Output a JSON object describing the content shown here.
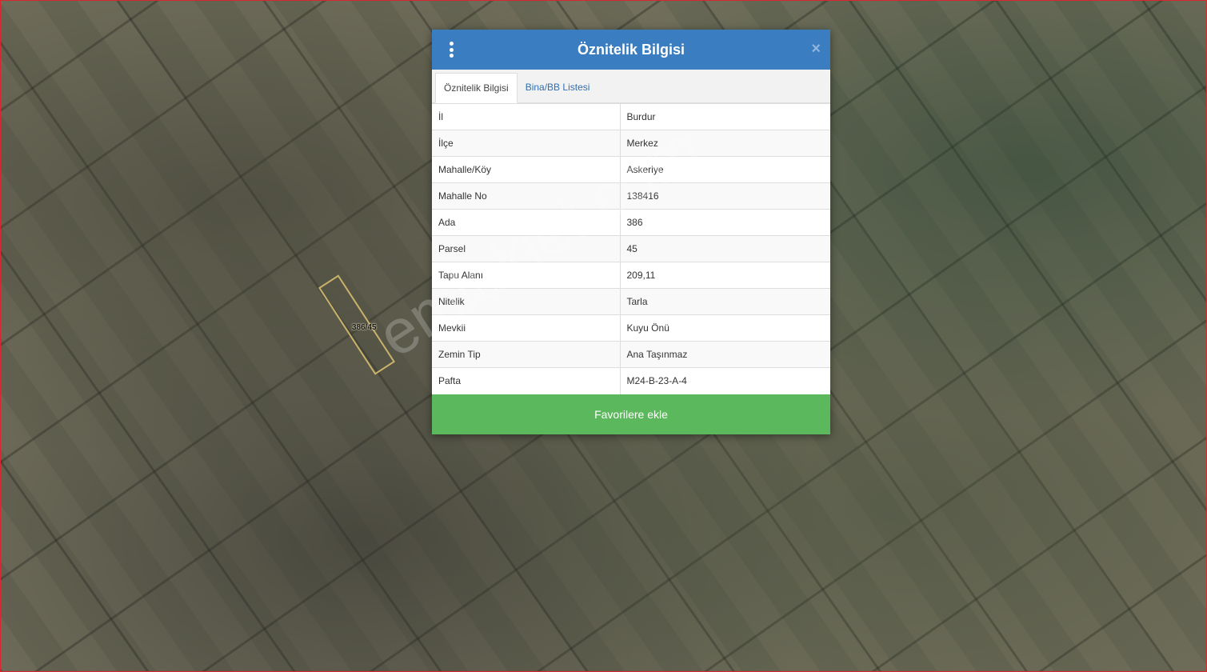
{
  "map": {
    "parcel_label": "386/45"
  },
  "watermark": "emlakjet.com",
  "dialog": {
    "title": "Öznitelik Bilgisi",
    "menu_icon": "vertical-dots-icon",
    "close_label": "×",
    "tabs": [
      {
        "label": "Öznitelik Bilgisi",
        "active": true
      },
      {
        "label": "Bina/BB Listesi",
        "active": false
      }
    ],
    "rows": [
      {
        "key": "İl",
        "value": "Burdur"
      },
      {
        "key": "İlçe",
        "value": "Merkez"
      },
      {
        "key": "Mahalle/Köy",
        "value": "Askeriye"
      },
      {
        "key": "Mahalle No",
        "value": "138416"
      },
      {
        "key": "Ada",
        "value": "386"
      },
      {
        "key": "Parsel",
        "value": "45"
      },
      {
        "key": "Tapu Alanı",
        "value": "209,11"
      },
      {
        "key": "Nitelik",
        "value": "Tarla"
      },
      {
        "key": "Mevkii",
        "value": "Kuyu Önü"
      },
      {
        "key": "Zemin Tip",
        "value": "Ana Taşınmaz"
      },
      {
        "key": "Pafta",
        "value": "M24-B-23-A-4"
      }
    ],
    "favorite_button": "Favorilere ekle"
  },
  "colors": {
    "header": "#3a7ec1",
    "favorite": "#5cb85c",
    "tab_link": "#2f6fb3",
    "parcel_outline": "#c9b36a",
    "frame_border": "#d9262f"
  }
}
